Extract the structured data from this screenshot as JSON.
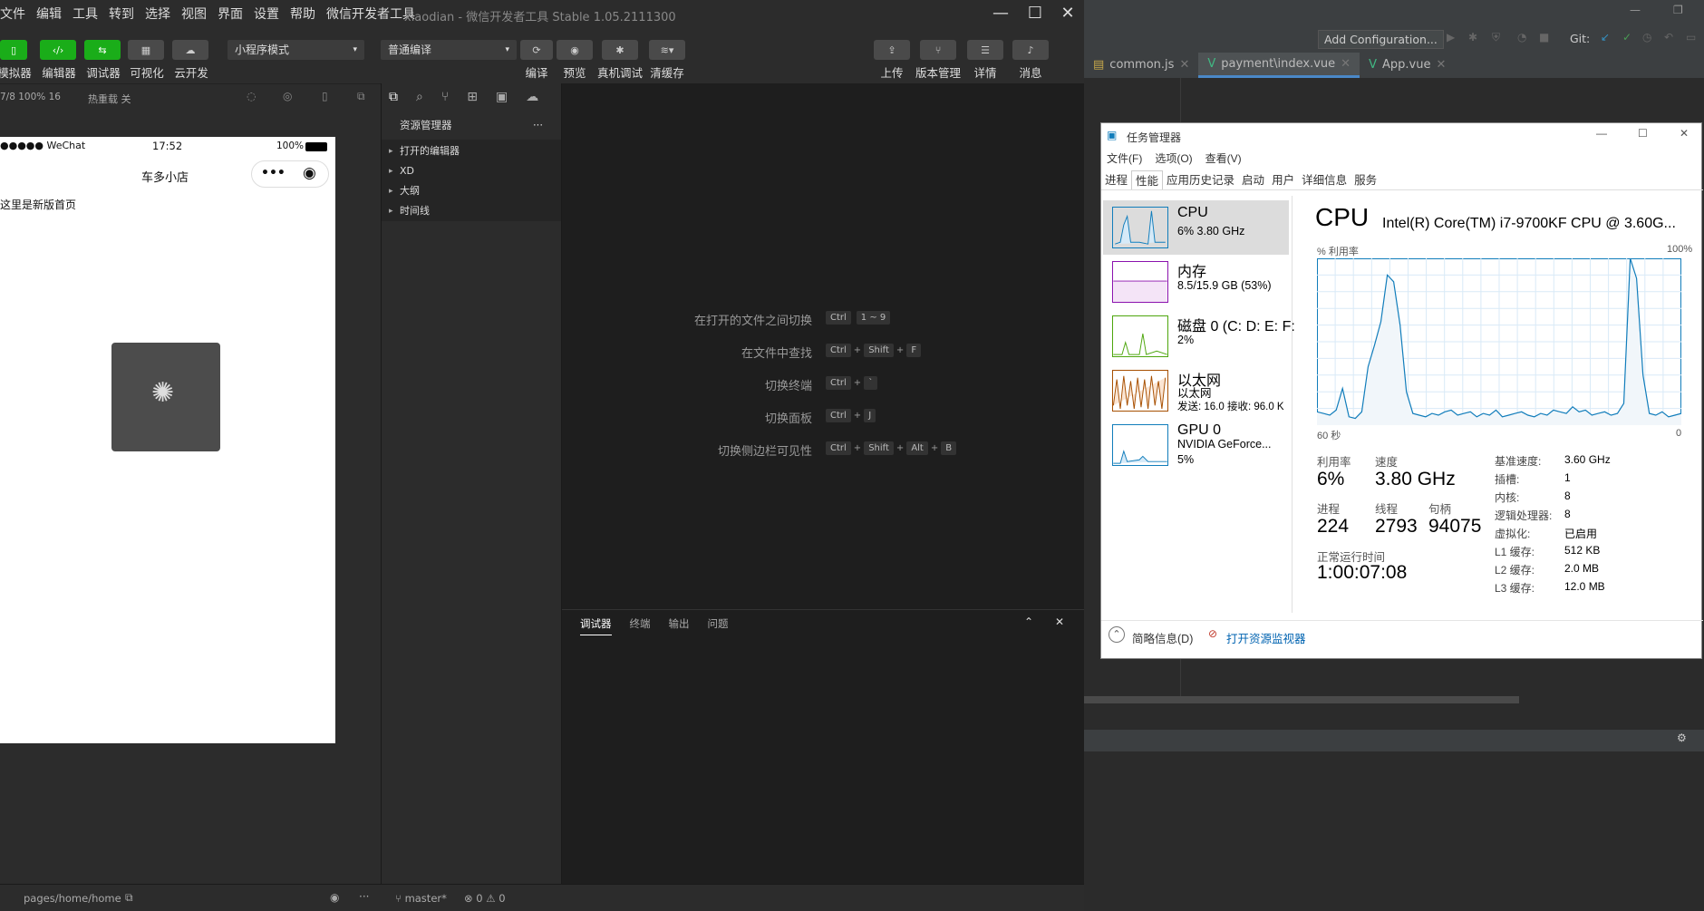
{
  "wx": {
    "menu": [
      "文件",
      "编辑",
      "工具",
      "转到",
      "选择",
      "视图",
      "界面",
      "设置",
      "帮助",
      "微信开发者工具"
    ],
    "title": "xiaodian - 微信开发者工具 Stable 1.05.2111300",
    "toolbar": {
      "simulator": "模拟器",
      "editor": "编辑器",
      "debugger": "调试器",
      "visual": "可视化",
      "cloud": "云开发",
      "mode": "小程序模式",
      "compile_mode": "普通编译",
      "compile": "编译",
      "preview": "预览",
      "device_debug": "真机调试",
      "clear_cache": "清缓存",
      "upload": "上传",
      "version": "版本管理",
      "details": "详情",
      "messages": "消息"
    },
    "sim_bar": {
      "device": "7/8 100% 16",
      "hot_reload": "热重载 关"
    },
    "phone": {
      "carrier": "●●●●● WeChat",
      "time": "17:52",
      "battery": "100%",
      "nav_title": "车多小店",
      "content": "这里是新版首页"
    },
    "explorer": {
      "title": "资源管理器",
      "items": [
        "打开的编辑器",
        "XD",
        "大纲",
        "时间线"
      ]
    },
    "shortcuts": [
      {
        "label": "在打开的文件之间切换",
        "keys": [
          "Ctrl",
          "1 ~ 9"
        ]
      },
      {
        "label": "在文件中查找",
        "keys": [
          "Ctrl",
          "Shift",
          "F"
        ]
      },
      {
        "label": "切换终端",
        "keys": [
          "Ctrl",
          "`"
        ]
      },
      {
        "label": "切换面板",
        "keys": [
          "Ctrl",
          "J"
        ]
      },
      {
        "label": "切换侧边栏可见性",
        "keys": [
          "Ctrl",
          "Shift",
          "Alt",
          "B"
        ]
      }
    ],
    "debug_tabs": [
      "调试器",
      "终端",
      "输出",
      "问题"
    ],
    "status": {
      "path": "pages/home/home",
      "branch": "master*",
      "errors": "0",
      "warnings": "0"
    }
  },
  "ide": {
    "add_config": "Add Configuration...",
    "git_label": "Git:",
    "tabs": [
      "common.js",
      "payment\\index.vue",
      "App.vue"
    ]
  },
  "tm": {
    "title": "任务管理器",
    "menu": [
      "文件(F)",
      "选项(O)",
      "查看(V)"
    ],
    "tabs": [
      "进程",
      "性能",
      "应用历史记录",
      "启动",
      "用户",
      "详细信息",
      "服务"
    ],
    "side": [
      {
        "title": "CPU",
        "sub1": "6% 3.80 GHz",
        "sub2": ""
      },
      {
        "title": "内存",
        "sub1": "8.5/15.9 GB (53%)",
        "sub2": ""
      },
      {
        "title": "磁盘 0 (C: D: E: F:",
        "sub1": "2%",
        "sub2": ""
      },
      {
        "title": "以太网",
        "sub1": "以太网",
        "sub2": "发送: 16.0 接收: 96.0 K"
      },
      {
        "title": "GPU 0",
        "sub1": "NVIDIA GeForce...",
        "sub2": "5%"
      }
    ],
    "cpu_title": "CPU",
    "cpu_model": "Intel(R) Core(TM) i7-9700KF CPU @ 3.60G...",
    "graph_label": "% 利用率",
    "graph_max": "100%",
    "graph_time": "60 秒",
    "graph_min": "0",
    "stats": {
      "util_label": "利用率",
      "util": "6%",
      "speed_label": "速度",
      "speed": "3.80 GHz",
      "proc_label": "进程",
      "proc": "224",
      "thread_label": "线程",
      "thread": "2793",
      "handle_label": "句柄",
      "handle": "94075",
      "uptime_label": "正常运行时间",
      "uptime": "1:00:07:08"
    },
    "details": [
      {
        "k": "基准速度:",
        "v": "3.60 GHz"
      },
      {
        "k": "插槽:",
        "v": "1"
      },
      {
        "k": "内核:",
        "v": "8"
      },
      {
        "k": "逻辑处理器:",
        "v": "8"
      },
      {
        "k": "虚拟化:",
        "v": "已启用"
      },
      {
        "k": "L1 缓存:",
        "v": "512 KB"
      },
      {
        "k": "L2 缓存:",
        "v": "2.0 MB"
      },
      {
        "k": "L3 缓存:",
        "v": "12.0 MB"
      }
    ],
    "footer_brief": "简略信息(D)",
    "footer_monitor": "打开资源监视器",
    "cpu_history": [
      8,
      7,
      6,
      9,
      22,
      5,
      4,
      8,
      35,
      48,
      62,
      90,
      86,
      60,
      20,
      7,
      6,
      5,
      7,
      6,
      8,
      9,
      6,
      7,
      8,
      5,
      7,
      6,
      9,
      5,
      6,
      7,
      8,
      6,
      5,
      7,
      6,
      9,
      8,
      7,
      11,
      8,
      9,
      6,
      7,
      8,
      6,
      7,
      13,
      100,
      88,
      30,
      7,
      6,
      8,
      5,
      6,
      7
    ],
    "colors": {
      "cpu": "#117dbb",
      "mem": "#8b12ae",
      "disk": "#4da60c",
      "net": "#a74f01",
      "gpu": "#117dbb"
    }
  }
}
